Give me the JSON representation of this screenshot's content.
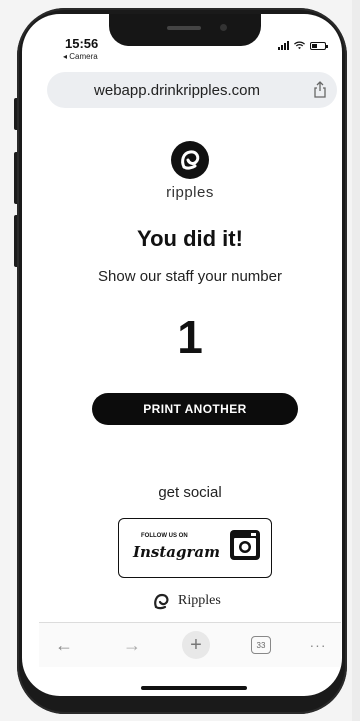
{
  "status": {
    "time": "15:56",
    "back_label": "◂ Camera"
  },
  "browser": {
    "url": "webapp.drinkripples.com"
  },
  "brand": {
    "logo_text": "ripples"
  },
  "main": {
    "headline": "You did it!",
    "subline": "Show our staff your number",
    "number": "1",
    "print_button": "PRINT ANOTHER",
    "social_label": "get social"
  },
  "instagram": {
    "small_label": "FOLLOW US ON",
    "wordmark": "Instagram"
  },
  "ripples_link": {
    "label": "Ripples"
  },
  "toolbar": {
    "back": "←",
    "forward": "→",
    "new_tab": "+",
    "tab_count": "33",
    "more": "···"
  },
  "colors": {
    "accent": "#111111",
    "url_bar": "#eceef1"
  },
  "icons": [
    "share-icon",
    "instagram-icon",
    "ripples-logo-icon",
    "back-arrow-icon",
    "forward-arrow-icon",
    "new-tab-icon",
    "tabs-icon",
    "more-icon"
  ]
}
